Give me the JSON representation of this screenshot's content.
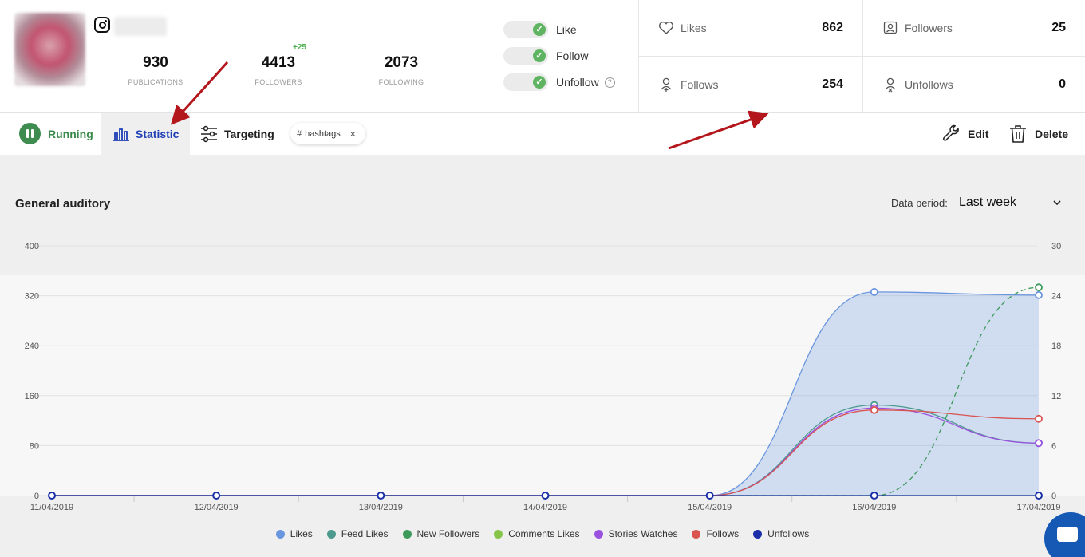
{
  "profile": {
    "stats": [
      {
        "value": "930",
        "label": "PUBLICATIONS"
      },
      {
        "value": "4413",
        "label": "FOLLOWERS"
      },
      {
        "value": "2073",
        "label": "FOLLOWING"
      }
    ],
    "followers_delta": "+25"
  },
  "toggles": [
    {
      "label": "Like",
      "enabled": true
    },
    {
      "label": "Follow",
      "enabled": true
    },
    {
      "label": "Unfollow",
      "enabled": true
    }
  ],
  "counters": {
    "likes": {
      "label": "Likes",
      "value": "862"
    },
    "followers": {
      "label": "Followers",
      "value": "25"
    },
    "follows": {
      "label": "Follows",
      "value": "254"
    },
    "unfollows": {
      "label": "Unfollows",
      "value": "0"
    }
  },
  "toolbar": {
    "running": "Running",
    "statistic": "Statistic",
    "targeting": "Targeting",
    "chip": "hashtags",
    "chip_close": "×",
    "edit": "Edit",
    "delete": "Delete"
  },
  "section": {
    "title": "General auditory",
    "period_label": "Data period:",
    "period_value": "Last week"
  },
  "chart_data": {
    "type": "line",
    "x": [
      "11/04/2019",
      "12/04/2019",
      "13/04/2019",
      "14/04/2019",
      "15/04/2019",
      "16/04/2019",
      "17/04/2019"
    ],
    "y_left_ticks": [
      "0",
      "80",
      "160",
      "240",
      "320",
      "400"
    ],
    "y_right_ticks": [
      "0",
      "6",
      "12",
      "18",
      "24",
      "30"
    ],
    "ylim_left": [
      0,
      400
    ],
    "ylim_right": [
      0,
      30
    ],
    "grid": true,
    "legend_position": "bottom",
    "series": [
      {
        "name": "Likes",
        "color": "#6a96df",
        "axis": "left",
        "fill": true,
        "values": [
          0,
          0,
          0,
          0,
          0,
          326,
          321
        ]
      },
      {
        "name": "Feed Likes",
        "color": "#4c9a8d",
        "axis": "left",
        "values": [
          0,
          0,
          0,
          0,
          0,
          145,
          84
        ]
      },
      {
        "name": "New Followers",
        "color": "#3d9a5a",
        "axis": "right",
        "dashed": true,
        "values": [
          0,
          0,
          0,
          0,
          0,
          0,
          25
        ]
      },
      {
        "name": "Comments Likes",
        "color": "#86c54a",
        "axis": "left",
        "values": [
          0,
          0,
          0,
          0,
          0,
          0,
          0
        ]
      },
      {
        "name": "Stories Watches",
        "color": "#9b51e0",
        "axis": "left",
        "values": [
          0,
          0,
          0,
          0,
          0,
          140,
          84
        ]
      },
      {
        "name": "Follows",
        "color": "#d9534f",
        "axis": "left",
        "values": [
          0,
          0,
          0,
          0,
          0,
          137,
          123
        ]
      },
      {
        "name": "Unfollows",
        "color": "#1a2fa8",
        "axis": "left",
        "values": [
          0,
          0,
          0,
          0,
          0,
          0,
          0
        ]
      }
    ]
  }
}
